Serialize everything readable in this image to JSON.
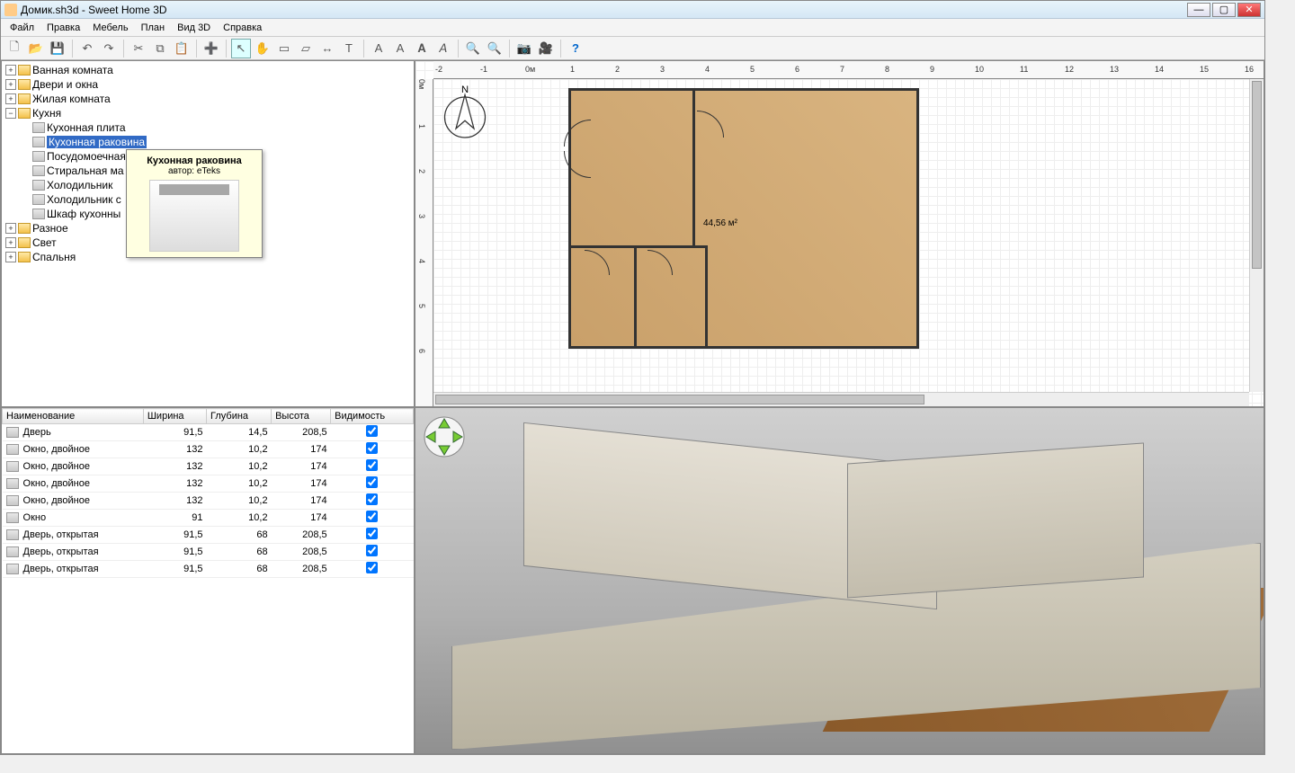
{
  "window": {
    "title": "Домик.sh3d - Sweet Home 3D"
  },
  "menu": [
    "Файл",
    "Правка",
    "Мебель",
    "План",
    "Вид 3D",
    "Справка"
  ],
  "tree": {
    "folders": [
      {
        "name": "Ванная комната",
        "expanded": false
      },
      {
        "name": "Двери и окна",
        "expanded": false
      },
      {
        "name": "Жилая комната",
        "expanded": false
      },
      {
        "name": "Кухня",
        "expanded": true,
        "items": [
          "Кухонная плита",
          "Кухонная раковина",
          "Посудомоечная",
          "Стиральная ма",
          "Холодильник",
          "Холодильник с",
          "Шкаф кухонны"
        ],
        "selected": "Кухонная раковина"
      },
      {
        "name": "Разное",
        "expanded": false
      },
      {
        "name": "Свет",
        "expanded": false
      },
      {
        "name": "Спальня",
        "expanded": false
      }
    ]
  },
  "tooltip": {
    "title": "Кухонная раковина",
    "subtitle": "автор: eTeks"
  },
  "table": {
    "columns": [
      "Наименование",
      "Ширина",
      "Глубина",
      "Высота",
      "Видимость"
    ],
    "rows": [
      {
        "name": "Дверь",
        "w": "91,5",
        "d": "14,5",
        "h": "208,5",
        "vis": true
      },
      {
        "name": "Окно, двойное",
        "w": "132",
        "d": "10,2",
        "h": "174",
        "vis": true
      },
      {
        "name": "Окно, двойное",
        "w": "132",
        "d": "10,2",
        "h": "174",
        "vis": true
      },
      {
        "name": "Окно, двойное",
        "w": "132",
        "d": "10,2",
        "h": "174",
        "vis": true
      },
      {
        "name": "Окно, двойное",
        "w": "132",
        "d": "10,2",
        "h": "174",
        "vis": true
      },
      {
        "name": "Окно",
        "w": "91",
        "d": "10,2",
        "h": "174",
        "vis": true
      },
      {
        "name": "Дверь, открытая",
        "w": "91,5",
        "d": "68",
        "h": "208,5",
        "vis": true
      },
      {
        "name": "Дверь, открытая",
        "w": "91,5",
        "d": "68",
        "h": "208,5",
        "vis": true
      },
      {
        "name": "Дверь, открытая",
        "w": "91,5",
        "d": "68",
        "h": "208,5",
        "vis": true
      }
    ]
  },
  "plan": {
    "room_area": "44,56 м²",
    "ruler_origin": "0м",
    "ruler_marks": [
      "-2",
      "-1",
      "0м",
      "1",
      "2",
      "3",
      "4",
      "5",
      "6",
      "7",
      "8",
      "9",
      "10",
      "11",
      "12",
      "13",
      "14",
      "15",
      "16"
    ],
    "ruler_marks_v": [
      "0м",
      "1",
      "2",
      "3",
      "4",
      "5",
      "6"
    ]
  },
  "compass_label": "N",
  "icons": {
    "new": "🗋",
    "open": "📂",
    "save": "💾",
    "undo": "↶",
    "redo": "↷",
    "cut": "✂",
    "copy": "⧉",
    "paste": "📋",
    "add": "➕",
    "select": "↖",
    "pan": "✋",
    "wall": "▭",
    "room": "▱",
    "dim": "↔",
    "text": "T",
    "zoom_out": "🔍-",
    "zoom_in": "🔍+",
    "photo": "📷",
    "video": "🎥",
    "help": "?"
  }
}
